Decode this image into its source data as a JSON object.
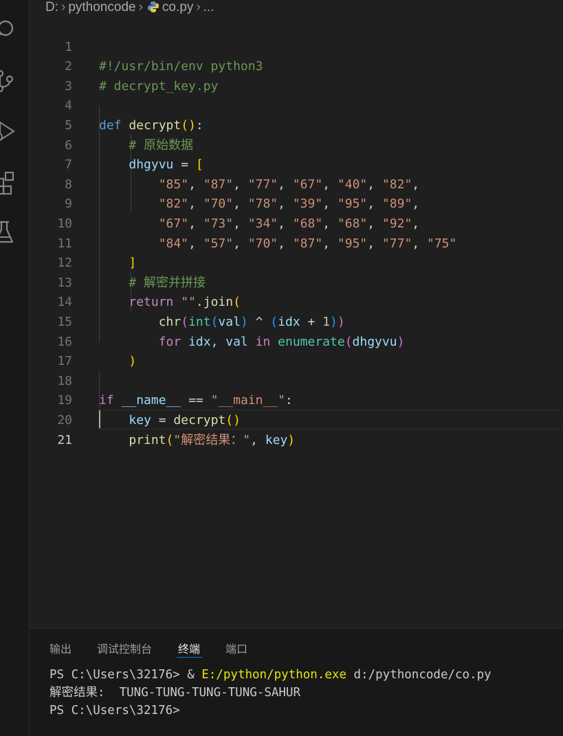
{
  "activity_bar": {
    "icons": [
      "search-icon",
      "source-control-icon",
      "run-debug-icon",
      "extensions-icon",
      "testing-icon"
    ]
  },
  "breadcrumb": {
    "drive": "D:",
    "folder": "pythoncode",
    "file": "co.py",
    "ellipsis": "..."
  },
  "editor": {
    "line_numbers": [
      "1",
      "2",
      "3",
      "4",
      "5",
      "6",
      "7",
      "8",
      "9",
      "10",
      "11",
      "12",
      "13",
      "14",
      "15",
      "16",
      "17",
      "18",
      "19",
      "20",
      "21"
    ],
    "active_line": "21",
    "code": {
      "l1": "#!/usr/bin/env python3",
      "l2": "# decrypt_key.py",
      "l4_def": "def",
      "l4_name": "decrypt",
      "l4_open": "(",
      "l4_close": ")",
      "l4_colon": ":",
      "l5": "# 原始数据",
      "l6_var": "dhgyvu",
      "l6_eq": " = ",
      "l6_bracket": "[",
      "row1": [
        "\"85\"",
        "\"87\"",
        "\"77\"",
        "\"67\"",
        "\"40\"",
        "\"82\""
      ],
      "row2": [
        "\"82\"",
        "\"70\"",
        "\"78\"",
        "\"39\"",
        "\"95\"",
        "\"89\""
      ],
      "row3": [
        "\"67\"",
        "\"73\"",
        "\"34\"",
        "\"68\"",
        "\"68\"",
        "\"92\""
      ],
      "row4": [
        "\"84\"",
        "\"57\"",
        "\"70\"",
        "\"87\"",
        "\"95\"",
        "\"77\"",
        "\"75\""
      ],
      "l11": "]",
      "l12": "# 解密并拼接",
      "l13_return": "return",
      "l13_str": "\"\"",
      "l13_join": ".join",
      "l13_paren": "(",
      "l14_chr": "chr",
      "l14_int": "int",
      "l14_val": "val",
      "l14_op": " ^ ",
      "l14_idx": "idx",
      "l14_plus": " + ",
      "l14_num": "1",
      "l15_for": "for",
      "l15_vars": "idx, val",
      "l15_in": "in",
      "l15_enum": "enumerate",
      "l15_arg": "dhgyvu",
      "l16": ")",
      "l18_if": "if",
      "l18_name": "__name__",
      "l18_eq": " == ",
      "l18_str": "\"__main__\"",
      "l18_colon": ":",
      "l19_key": "key",
      "l19_eq": " = ",
      "l19_fn": "decrypt",
      "l19_parens": "()",
      "l20_print": "print",
      "l20_str": "\"解密结果：\"",
      "l20_comma": ", ",
      "l20_key": "key"
    }
  },
  "panel": {
    "tabs": [
      "输出",
      "调试控制台",
      "终端",
      "端口"
    ],
    "active_tab": "终端",
    "terminal": {
      "line1_prompt": "PS C:\\Users\\32176> ",
      "line1_amp": "& ",
      "line1_exe": "E:/python/python.exe",
      "line1_arg": " d:/pythoncode/co.py",
      "line2": "解密结果:  TUNG-TUNG-TUNG-TUNG-SAHUR",
      "line3": "PS C:\\Users\\32176>"
    }
  },
  "colors": {
    "background": "#1f1f1f",
    "keyword": "#569cd6",
    "control": "#c586c0",
    "function": "#dcdcaa",
    "variable": "#9cdcfe",
    "string": "#ce9178",
    "comment": "#6a9955",
    "number": "#b5cea8",
    "accent": "#0078d4"
  }
}
